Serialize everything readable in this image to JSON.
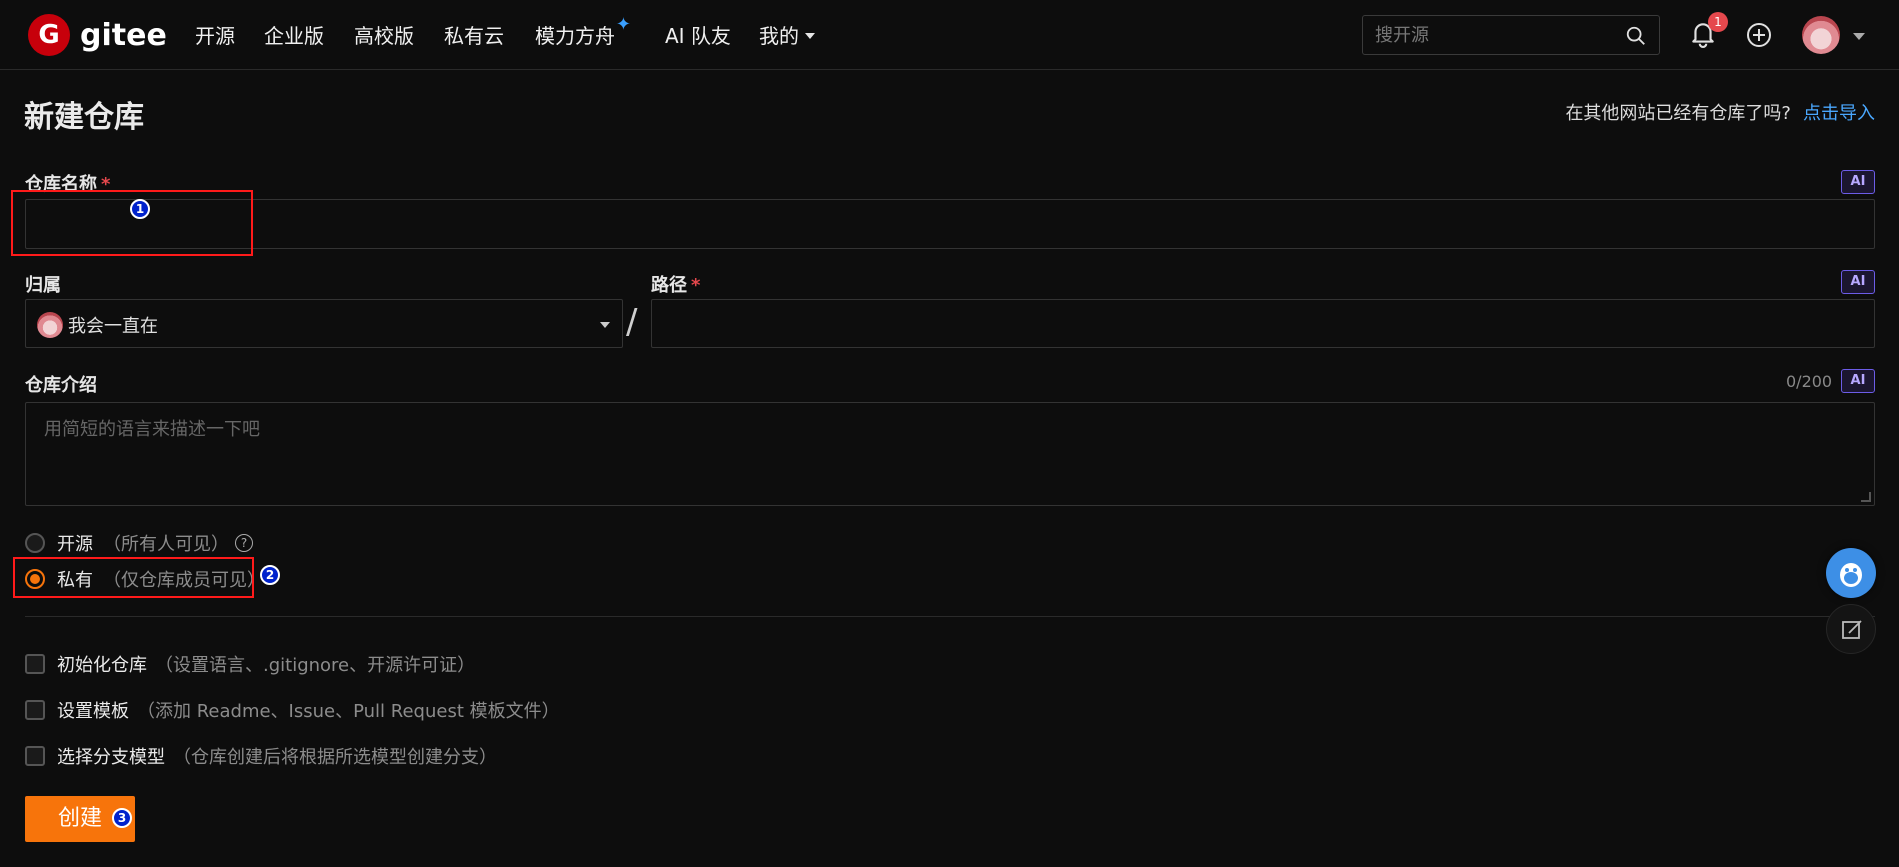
{
  "nav": {
    "logo_text": "gitee",
    "logo_letter": "G",
    "items": [
      "开源",
      "企业版",
      "高校版",
      "私有云",
      "模力方舟",
      "AI 队友",
      "我的"
    ],
    "sparkle": "✦",
    "search_placeholder": "搜开源",
    "notification_count": "1"
  },
  "page": {
    "title": "新建仓库",
    "import_hint": "在其他网站已经有仓库了吗?",
    "import_link": "点击导入"
  },
  "form": {
    "repo_name_label": "仓库名称",
    "required_mark": "*",
    "ai_label": "AI",
    "owner_label": "归属",
    "owner_value": "我会一直在",
    "path_label": "路径",
    "slash": "/",
    "desc_label": "仓库介绍",
    "desc_counter": "0/200",
    "desc_placeholder": "用简短的语言来描述一下吧",
    "visibility": {
      "public_label": "开源",
      "public_sub": "（所有人可见）",
      "help": "?",
      "private_label": "私有",
      "private_sub": "（仅仓库成员可见）",
      "selected": "private"
    },
    "options": [
      {
        "label": "初始化仓库",
        "sub": "（设置语言、.gitignore、开源许可证）",
        "checked": false
      },
      {
        "label": "设置模板",
        "sub": "（添加 Readme、Issue、Pull Request 模板文件）",
        "checked": false
      },
      {
        "label": "选择分支模型",
        "sub": "（仓库创建后将根据所选模型创建分支）",
        "checked": false
      }
    ],
    "create_button": "创建"
  },
  "annotations": [
    "1",
    "2",
    "3"
  ],
  "colors": {
    "accent": "#f7740b",
    "link": "#4aa8ff",
    "highlight_box": "#ff1a1a",
    "marker": "#0022cc",
    "background": "#0d0d0d"
  }
}
